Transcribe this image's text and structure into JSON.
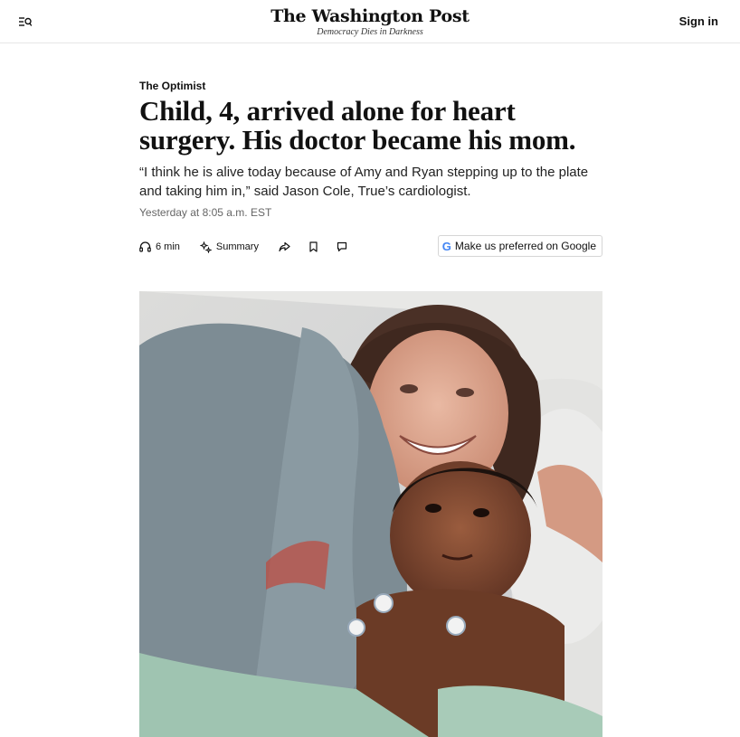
{
  "header": {
    "logo": "The Washington Post",
    "tagline": "Democracy Dies in Darkness",
    "signin_label": "Sign in"
  },
  "article": {
    "kicker": "The Optimist",
    "headline": "Child, 4, arrived alone for heart surgery. His doctor became his mom.",
    "dek": "“I think he is alive today because of Amy and Ryan stepping up to the plate and taking him in,” said Jason Cole, True’s cardiologist.",
    "timestamp": "Yesterday at 8:05 a.m. EST"
  },
  "toolbar": {
    "read_time": "6 min",
    "summary_label": "Summary",
    "google_label": "Make us preferred on Google",
    "google_g": "G"
  },
  "icons": {
    "menu": "menu-search-icon",
    "read_time": "headphones-icon",
    "summary": "sparkle-icon",
    "share": "share-icon",
    "save": "bookmark-icon",
    "comments": "comment-icon"
  },
  "colors": {
    "text": "#111111",
    "muted": "#666666",
    "border": "#e6e6e6",
    "google_blue": "#4285F4"
  }
}
